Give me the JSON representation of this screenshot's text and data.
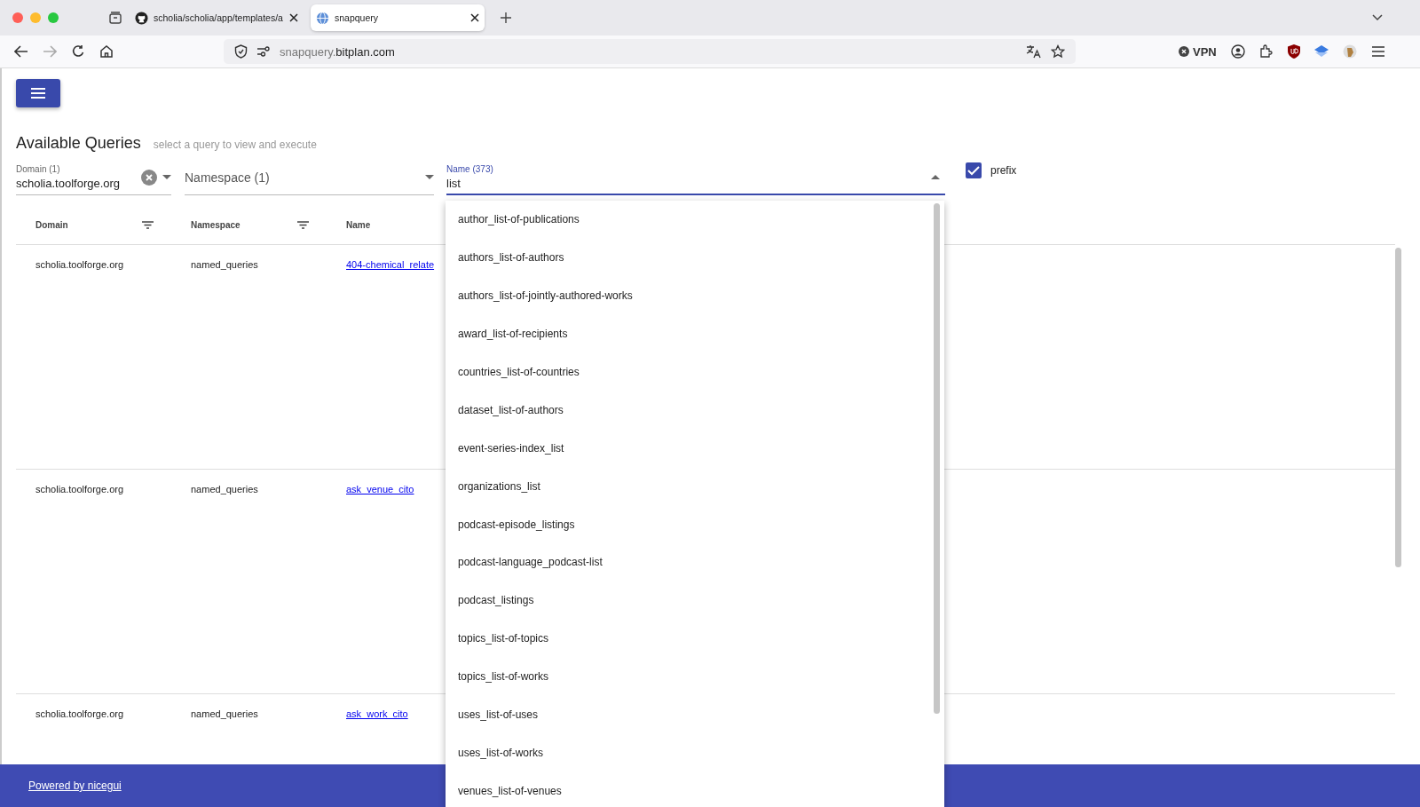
{
  "browser": {
    "tabs": [
      {
        "title": "scholia/scholia/app/templates/a",
        "selected": false,
        "kind": "github"
      },
      {
        "title": "snapquery",
        "selected": true,
        "kind": "globe"
      }
    ],
    "url": {
      "subdomain": "snapquery.",
      "domain": "bitplan.com"
    },
    "vpn": "VPN"
  },
  "page": {
    "heading": "Available Queries",
    "subheading": "select a query to view and execute",
    "filters": {
      "domain": {
        "label": "Domain (1)",
        "value": "scholia.toolforge.org"
      },
      "namespace": {
        "label": "Namespace (1)"
      },
      "name": {
        "label": "Name (373)",
        "value": "list",
        "expanded": true
      },
      "prefix": {
        "label": "prefix",
        "checked": true
      }
    },
    "table": {
      "columns": [
        "Domain",
        "Namespace",
        "Name"
      ],
      "rows": [
        {
          "domain": "scholia.toolforge.org",
          "namespace": "named_queries",
          "name": "404-chemical_relate"
        },
        {
          "domain": "scholia.toolforge.org",
          "namespace": "named_queries",
          "name": "ask_venue_cito"
        },
        {
          "domain": "scholia.toolforge.org",
          "namespace": "named_queries",
          "name": "ask_work_cito"
        }
      ]
    },
    "dropdown": [
      "author_list-of-publications",
      "authors_list-of-authors",
      "authors_list-of-jointly-authored-works",
      "award_list-of-recipients",
      "countries_list-of-countries",
      "dataset_list-of-authors",
      "event-series-index_list",
      "organizations_list",
      "podcast-episode_listings",
      "podcast-language_podcast-list",
      "podcast_listings",
      "topics_list-of-topics",
      "topics_list-of-works",
      "uses_list-of-uses",
      "uses_list-of-works",
      "venues_list-of-venues"
    ],
    "footer": {
      "link": "Powered by nicegui"
    }
  }
}
